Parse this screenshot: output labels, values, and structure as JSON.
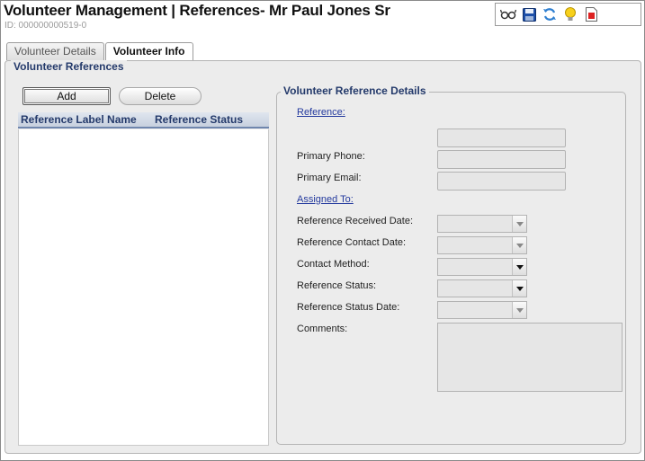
{
  "window": {
    "title": "Volunteer Management  |  References- Mr Paul Jones Sr",
    "record_id": "ID: 000000000519-0"
  },
  "toolbar": {
    "icons": [
      "glasses-icon",
      "save-icon",
      "refresh-icon",
      "lightbulb-icon",
      "pdf-report-icon"
    ]
  },
  "tabs": [
    {
      "label": "Volunteer Details",
      "active": false
    },
    {
      "label": "Volunteer Info",
      "active": true
    }
  ],
  "references_panel": {
    "legend": "Volunteer References",
    "add_label": "Add",
    "delete_label": "Delete",
    "columns": [
      "Reference Label Name",
      "Reference Status"
    ],
    "rows": []
  },
  "details": {
    "legend": "Volunteer Reference Details",
    "reference_link": "Reference:",
    "primary_phone_label": "Primary Phone:",
    "primary_email_label": "Primary Email:",
    "assigned_to_link": "Assigned To:",
    "ref_received_date_label": "Reference Received Date:",
    "ref_contact_date_label": "Reference Contact Date:",
    "contact_method_label": "Contact Method:",
    "ref_status_label": "Reference Status:",
    "ref_status_date_label": "Reference Status Date:",
    "comments_label": "Comments:",
    "values": {
      "reference": "",
      "primary_phone": "",
      "primary_email": "",
      "ref_received_date": "",
      "ref_contact_date": "",
      "contact_method": "",
      "ref_status": "",
      "ref_status_date": "",
      "comments": ""
    }
  }
}
